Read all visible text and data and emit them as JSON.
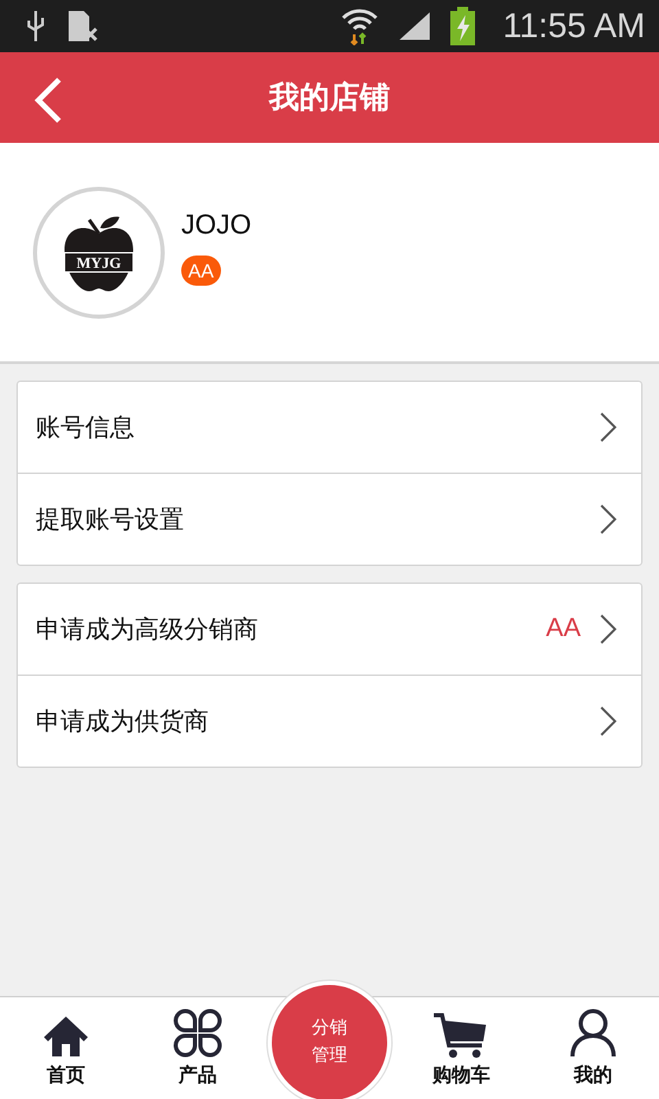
{
  "status_bar": {
    "time": "11:55 AM"
  },
  "header": {
    "title": "我的店铺"
  },
  "profile": {
    "logo_text": "MYJG",
    "name": "JOJO",
    "badge": "AA"
  },
  "menu_groups": [
    {
      "items": [
        {
          "label": "账号信息"
        },
        {
          "label": "提取账号设置"
        }
      ]
    },
    {
      "items": [
        {
          "label": "申请成为高级分销商",
          "value": "AA"
        },
        {
          "label": "申请成为供货商"
        }
      ]
    }
  ],
  "bottom_nav": [
    {
      "kind": "home",
      "label": "首页"
    },
    {
      "kind": "products",
      "label": "产品"
    },
    {
      "kind": "center",
      "label": "分销管理"
    },
    {
      "kind": "cart",
      "label": "购物车"
    },
    {
      "kind": "me",
      "label": "我的"
    }
  ]
}
